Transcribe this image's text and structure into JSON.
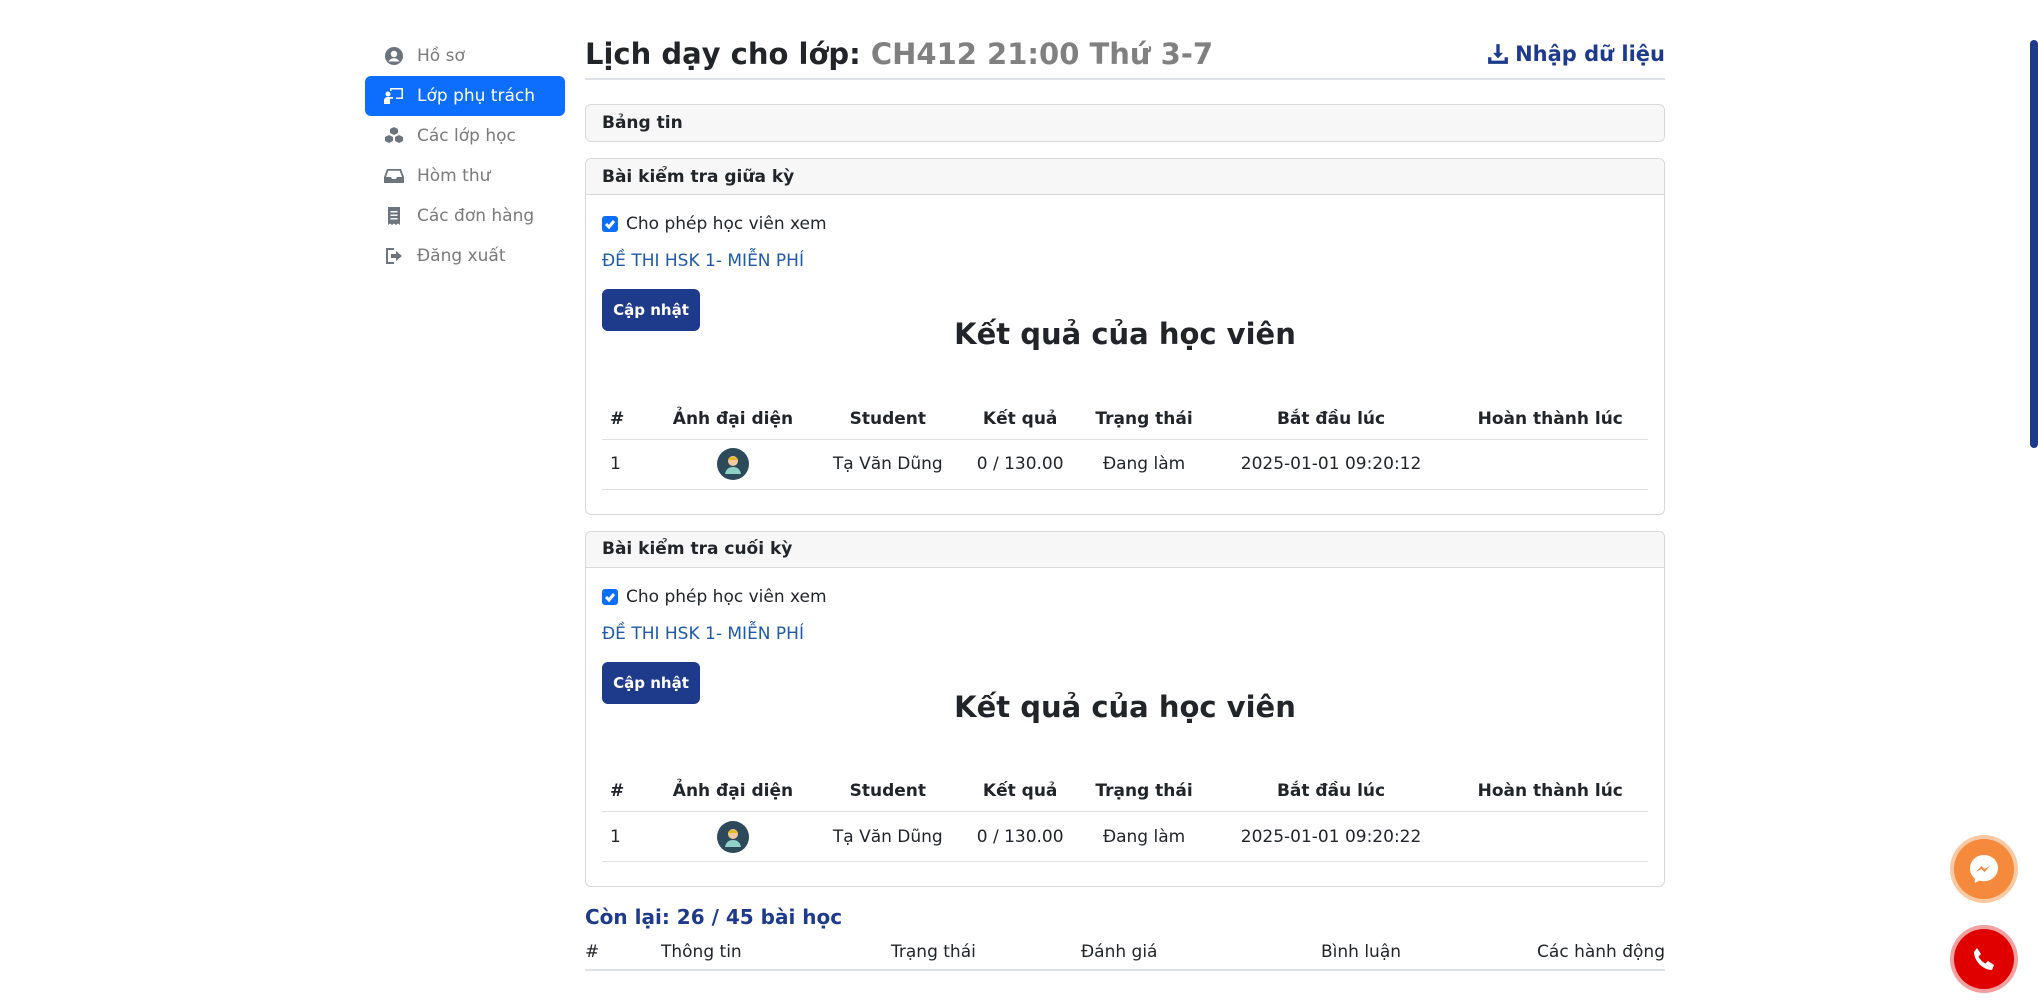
{
  "sidebar": {
    "items": [
      {
        "label": "Hồ sơ",
        "icon": "user-circle-icon"
      },
      {
        "label": "Lớp phụ trách",
        "icon": "chalkboard-teacher-icon"
      },
      {
        "label": "Các lớp học",
        "icon": "cubes-icon"
      },
      {
        "label": "Hòm thư",
        "icon": "inbox-icon"
      },
      {
        "label": "Các đơn hàng",
        "icon": "receipt-icon"
      },
      {
        "label": "Đăng xuất",
        "icon": "sign-out-icon"
      }
    ],
    "active_index": 1
  },
  "header": {
    "title_prefix": "Lịch dạy cho lớp:",
    "class_name": "CH412 21:00 Thứ 3-7",
    "import_label": "Nhập dữ liệu"
  },
  "news": {
    "title": "Bảng tin"
  },
  "midterm": {
    "title": "Bài kiểm tra giữa kỳ",
    "checkbox_label": "Cho phép học viên xem",
    "exam_link": "ĐỀ THI HSK 1- MIỄN PHÍ",
    "update_label": "Cập nhật",
    "results_title": "Kết quả của học viên",
    "columns": [
      "#",
      "Ảnh đại diện",
      "Student",
      "Kết quả",
      "Trạng thái",
      "Bắt đầu lúc",
      "Hoàn thành lúc"
    ],
    "rows": [
      {
        "index": "1",
        "student": "Tạ Văn Dũng",
        "score": "0 / 130.00",
        "status": "Đang làm",
        "started": "2025-01-01 09:20:12",
        "finished": ""
      }
    ]
  },
  "final": {
    "title": "Bài kiểm tra cuối kỳ",
    "checkbox_label": "Cho phép học viên xem",
    "exam_link": "ĐỀ THI HSK 1- MIỄN PHÍ",
    "update_label": "Cập nhật",
    "results_title": "Kết quả của học viên",
    "columns": [
      "#",
      "Ảnh đại diện",
      "Student",
      "Kết quả",
      "Trạng thái",
      "Bắt đầu lúc",
      "Hoàn thành lúc"
    ],
    "rows": [
      {
        "index": "1",
        "student": "Tạ Văn Dũng",
        "score": "0 / 130.00",
        "status": "Đang làm",
        "started": "2025-01-01 09:20:22",
        "finished": ""
      }
    ]
  },
  "lessons": {
    "remaining": "Còn lại: 26 / 45 bài học",
    "columns": [
      "#",
      "Thông tin",
      "Trạng thái",
      "Đánh giá",
      "Bình luận",
      "Các hành động"
    ]
  },
  "colors": {
    "accent": "#0d6efd",
    "brand": "#1e3a8a",
    "messenger": "#f58a3d",
    "phone": "#e00000"
  }
}
